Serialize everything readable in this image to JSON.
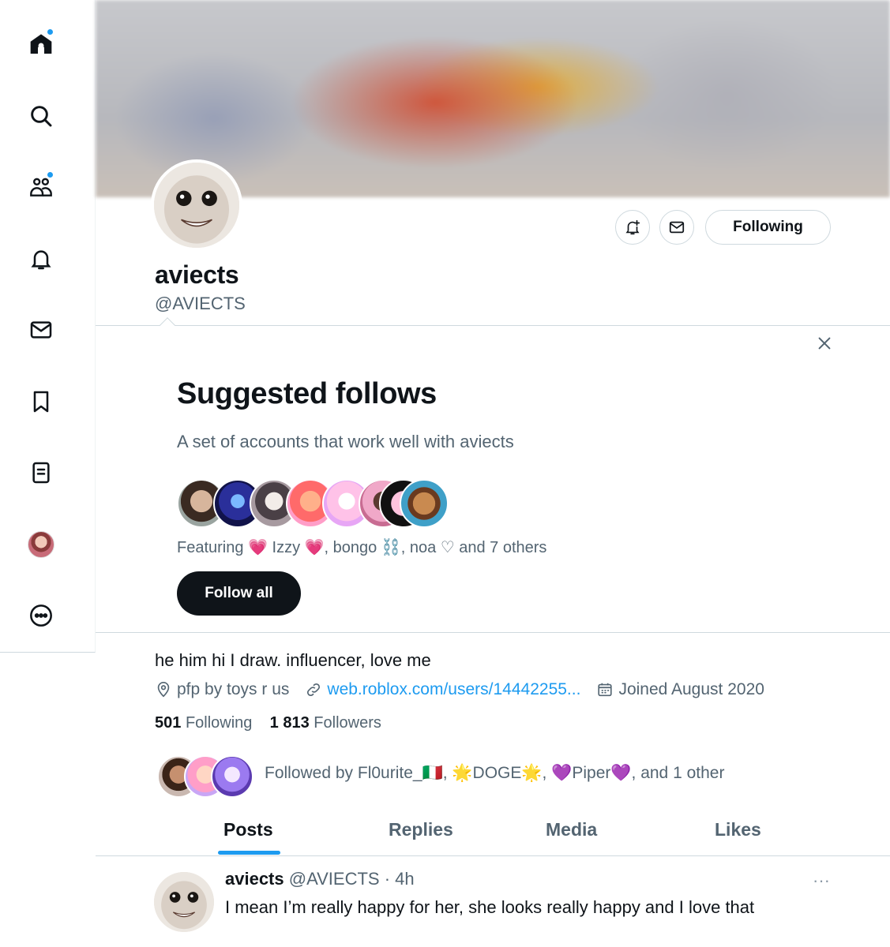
{
  "profile": {
    "display_name": "aviects",
    "handle": "@AVIECTS",
    "following_button": "Following",
    "bio": "he him hi I draw. influencer, love me",
    "location": "pfp by toys r us",
    "website": "web.roblox.com/users/14442255...",
    "joined": "Joined August 2020",
    "following_count": "501",
    "following_label": "Following",
    "followers_count": "1 813",
    "followers_label": "Followers",
    "followed_by": "Followed by Fl0urite_🇮🇹, 🌟DOGE🌟, 💜Piper💜, and 1 other"
  },
  "suggested": {
    "title": "Suggested follows",
    "subtitle": "A set of accounts that work well with aviects",
    "featuring": "Featuring 💗 Izzy 💗, bongo ⛓️, noa ♡ and 7 others",
    "follow_all": "Follow all"
  },
  "tabs": [
    "Posts",
    "Replies",
    "Media",
    "Likes"
  ],
  "active_tab": "Posts",
  "post": {
    "name": "aviects",
    "meta": "@AVIECTS · 4h",
    "text": "I mean I’m really happy for her, she looks really happy and I love that",
    "more": "···"
  },
  "sidebar": {
    "items": [
      "home-icon",
      "search-icon",
      "communities-icon",
      "notifications-icon",
      "messages-icon",
      "bookmarks-icon",
      "lists-icon",
      "profile-avatar",
      "more-icon"
    ]
  },
  "colors": {
    "accent": "#1d9bf0",
    "text": "#0f1419",
    "muted": "#536471",
    "border": "#cfd9de"
  }
}
